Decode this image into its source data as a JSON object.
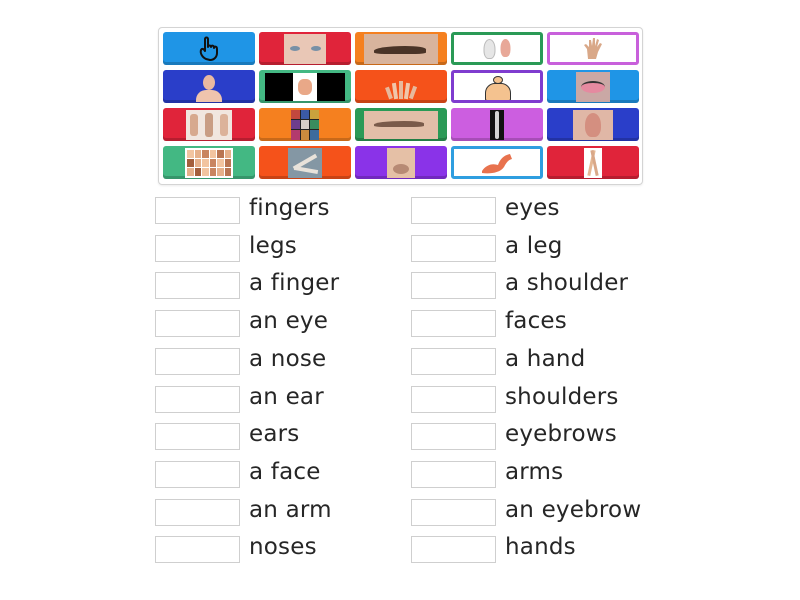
{
  "activity": {
    "type": "match-up",
    "tiles": [
      {
        "icon": "pointing-finger-icon",
        "color": "#1f95e6",
        "framed": false
      },
      {
        "icon": "eyes-photo-icon",
        "color": "#e0243a",
        "framed": false
      },
      {
        "icon": "eyebrow-photo-icon",
        "color": "#f5801f",
        "framed": false
      },
      {
        "icon": "ears-photo-icon",
        "color": "#2a9a56",
        "framed": true
      },
      {
        "icon": "hand-photo-icon",
        "color": "#c860db",
        "framed": true
      },
      {
        "icon": "face-photo-icon",
        "color": "#2a3ec9",
        "framed": false
      },
      {
        "icon": "shoulder-diagram-icon",
        "color": "#43b883",
        "framed": false
      },
      {
        "icon": "fingers-photo-icon",
        "color": "#f5521a",
        "framed": false
      },
      {
        "icon": "shoulders-diagram-icon",
        "color": "#7f3ccf",
        "framed": true
      },
      {
        "icon": "eye-makeup-photo-icon",
        "color": "#1f95e6",
        "framed": false
      },
      {
        "icon": "hands-photo-icon",
        "color": "#e0243a",
        "framed": false
      },
      {
        "icon": "faces-collage-icon",
        "color": "#f5801f",
        "framed": false
      },
      {
        "icon": "eyebrows-photo-icon",
        "color": "#2a9a56",
        "framed": false
      },
      {
        "icon": "leg-xray-icon",
        "color": "#cc5ee0",
        "framed": false
      },
      {
        "icon": "ear-photo-icon",
        "color": "#2a3ec9",
        "framed": false
      },
      {
        "icon": "noses-chart-icon",
        "color": "#43b883",
        "framed": false
      },
      {
        "icon": "arms-photo-icon",
        "color": "#f5521a",
        "framed": false
      },
      {
        "icon": "nose-photo-icon",
        "color": "#8a33e8",
        "framed": false
      },
      {
        "icon": "arm-muscle-icon",
        "color": "#2f9ee0",
        "framed": true
      },
      {
        "icon": "legs-photo-icon",
        "color": "#e0243a",
        "framed": false
      }
    ],
    "left_column": [
      "fingers",
      "legs",
      "a finger",
      "an eye",
      "a nose",
      "an ear",
      "ears",
      "a face",
      "an arm",
      "noses"
    ],
    "right_column": [
      "eyes",
      "a leg",
      "a shoulder",
      "faces",
      "a hand",
      "shoulders",
      "eyebrows",
      "arms",
      "an eyebrow",
      "hands"
    ]
  }
}
